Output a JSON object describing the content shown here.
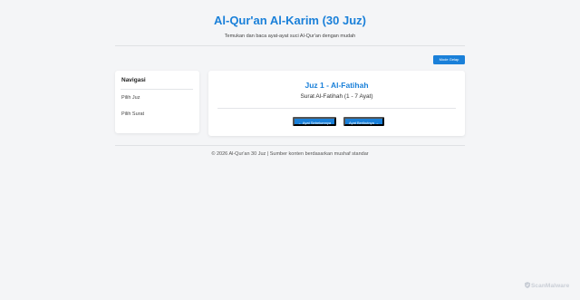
{
  "header": {
    "title": "Al-Qur'an Al-Karim (30 Juz)",
    "subtitle": "Temukan dan baca ayat-ayat suci Al-Qur'an dengan mudah"
  },
  "toolbar": {
    "dark_mode_label": "Mode Gelap"
  },
  "sidebar": {
    "heading": "Navigasi",
    "items": [
      {
        "label": "Pilih Juz"
      },
      {
        "label": "Pilih Surat"
      }
    ]
  },
  "content": {
    "juz_title": "Juz 1 - Al-Fatihah",
    "surah_info": "Surat Al-Fatihah (1 - 7 Ayat)",
    "prev_label": "← Ayat Sebelumnya",
    "next_label": "Ayat Berikutnya →"
  },
  "footer": {
    "text": "© 2026 Al-Qur'an 30 Juz | Sumber konten berdasarkan mushaf standar"
  },
  "watermark": {
    "text": "ScanMalware"
  },
  "colors": {
    "accent": "#1a80d9",
    "background": "#f4f5f7",
    "card": "#ffffff"
  }
}
